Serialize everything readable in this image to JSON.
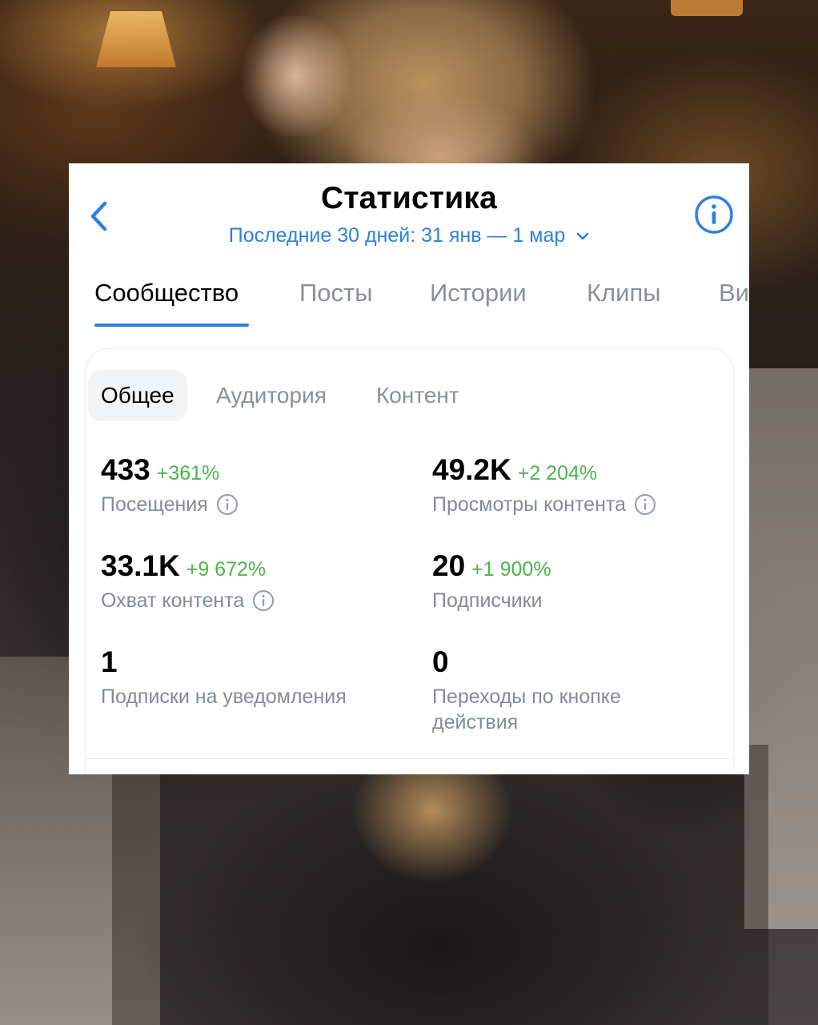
{
  "header": {
    "title": "Статистика",
    "period": "Последние 30 дней: 31 янв — 1 мар"
  },
  "tabs": [
    {
      "label": "Сообщество",
      "active": true
    },
    {
      "label": "Посты",
      "active": false
    },
    {
      "label": "Истории",
      "active": false
    },
    {
      "label": "Клипы",
      "active": false
    },
    {
      "label": "Ви",
      "active": false
    }
  ],
  "subtabs": [
    {
      "label": "Общее",
      "active": true
    },
    {
      "label": "Аудитория",
      "active": false
    },
    {
      "label": "Контент",
      "active": false
    }
  ],
  "metrics": [
    {
      "value": "433",
      "delta": "+361%",
      "label": "Посещения",
      "has_info": true
    },
    {
      "value": "49.2K",
      "delta": "+2 204%",
      "label": "Просмотры контента",
      "has_info": true
    },
    {
      "value": "33.1K",
      "delta": "+9 672%",
      "label": "Охват контента",
      "has_info": true
    },
    {
      "value": "20",
      "delta": "+1 900%",
      "label": "Подписчики",
      "has_info": false
    },
    {
      "value": "1",
      "delta": "",
      "label": "Подписки на уведомления",
      "has_info": false
    },
    {
      "value": "0",
      "delta": "",
      "label": "Переходы по кнопке действия",
      "has_info": false
    }
  ],
  "colors": {
    "accent": "#2d81e0",
    "positive": "#4bb34b",
    "secondary_text": "#818c99",
    "inactive_tab": "#8b9097"
  },
  "icons": {
    "back": "chevron-left-icon",
    "info": "info-circle-icon",
    "dropdown": "chevron-down-icon"
  }
}
